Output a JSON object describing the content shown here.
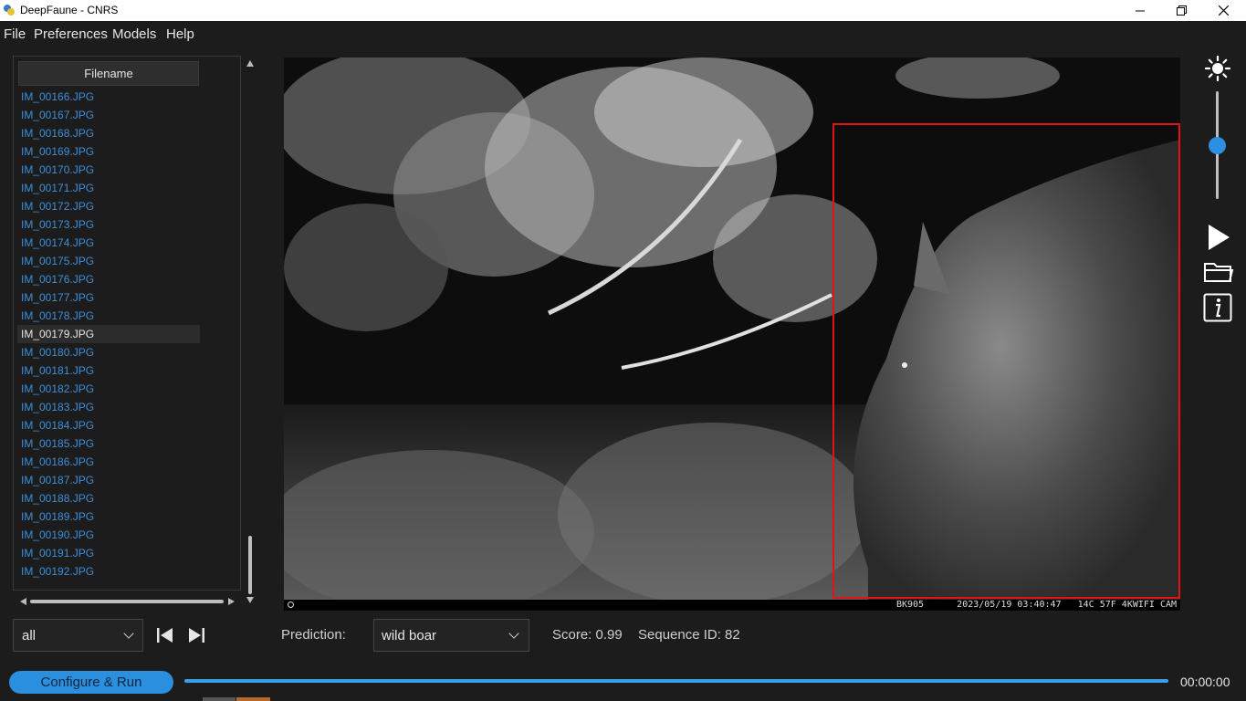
{
  "window": {
    "title": "DeepFaune - CNRS"
  },
  "menu": [
    "File",
    "Preferences",
    "Models",
    "Help"
  ],
  "table": {
    "header": "Filename",
    "files": [
      "IM_00166.JPG",
      "IM_00167.JPG",
      "IM_00168.JPG",
      "IM_00169.JPG",
      "IM_00170.JPG",
      "IM_00171.JPG",
      "IM_00172.JPG",
      "IM_00173.JPG",
      "IM_00174.JPG",
      "IM_00175.JPG",
      "IM_00176.JPG",
      "IM_00177.JPG",
      "IM_00178.JPG",
      "IM_00179.JPG",
      "IM_00180.JPG",
      "IM_00181.JPG",
      "IM_00182.JPG",
      "IM_00183.JPG",
      "IM_00184.JPG",
      "IM_00185.JPG",
      "IM_00186.JPG",
      "IM_00187.JPG",
      "IM_00188.JPG",
      "IM_00189.JPG",
      "IM_00190.JPG",
      "IM_00191.JPG",
      "IM_00192.JPG"
    ],
    "selected": "IM_00179.JPG"
  },
  "image": {
    "camera_overlay": "BK905      2023/05/19 03:40:47   14C 57F 4KWIFI CAM"
  },
  "controls": {
    "filter_value": "all",
    "prediction_label": "Prediction:",
    "prediction_value": "wild boar",
    "score_text": "Score: 0.99",
    "sequence_text": "Sequence ID: 82",
    "run_label": "Configure & Run",
    "time": "00:00:00",
    "brightness_level": 0.5
  },
  "colors": {
    "accent": "#2b8fe0",
    "link": "#3d8fd8",
    "bbox": "#e01414",
    "background": "#1c1c1c"
  }
}
